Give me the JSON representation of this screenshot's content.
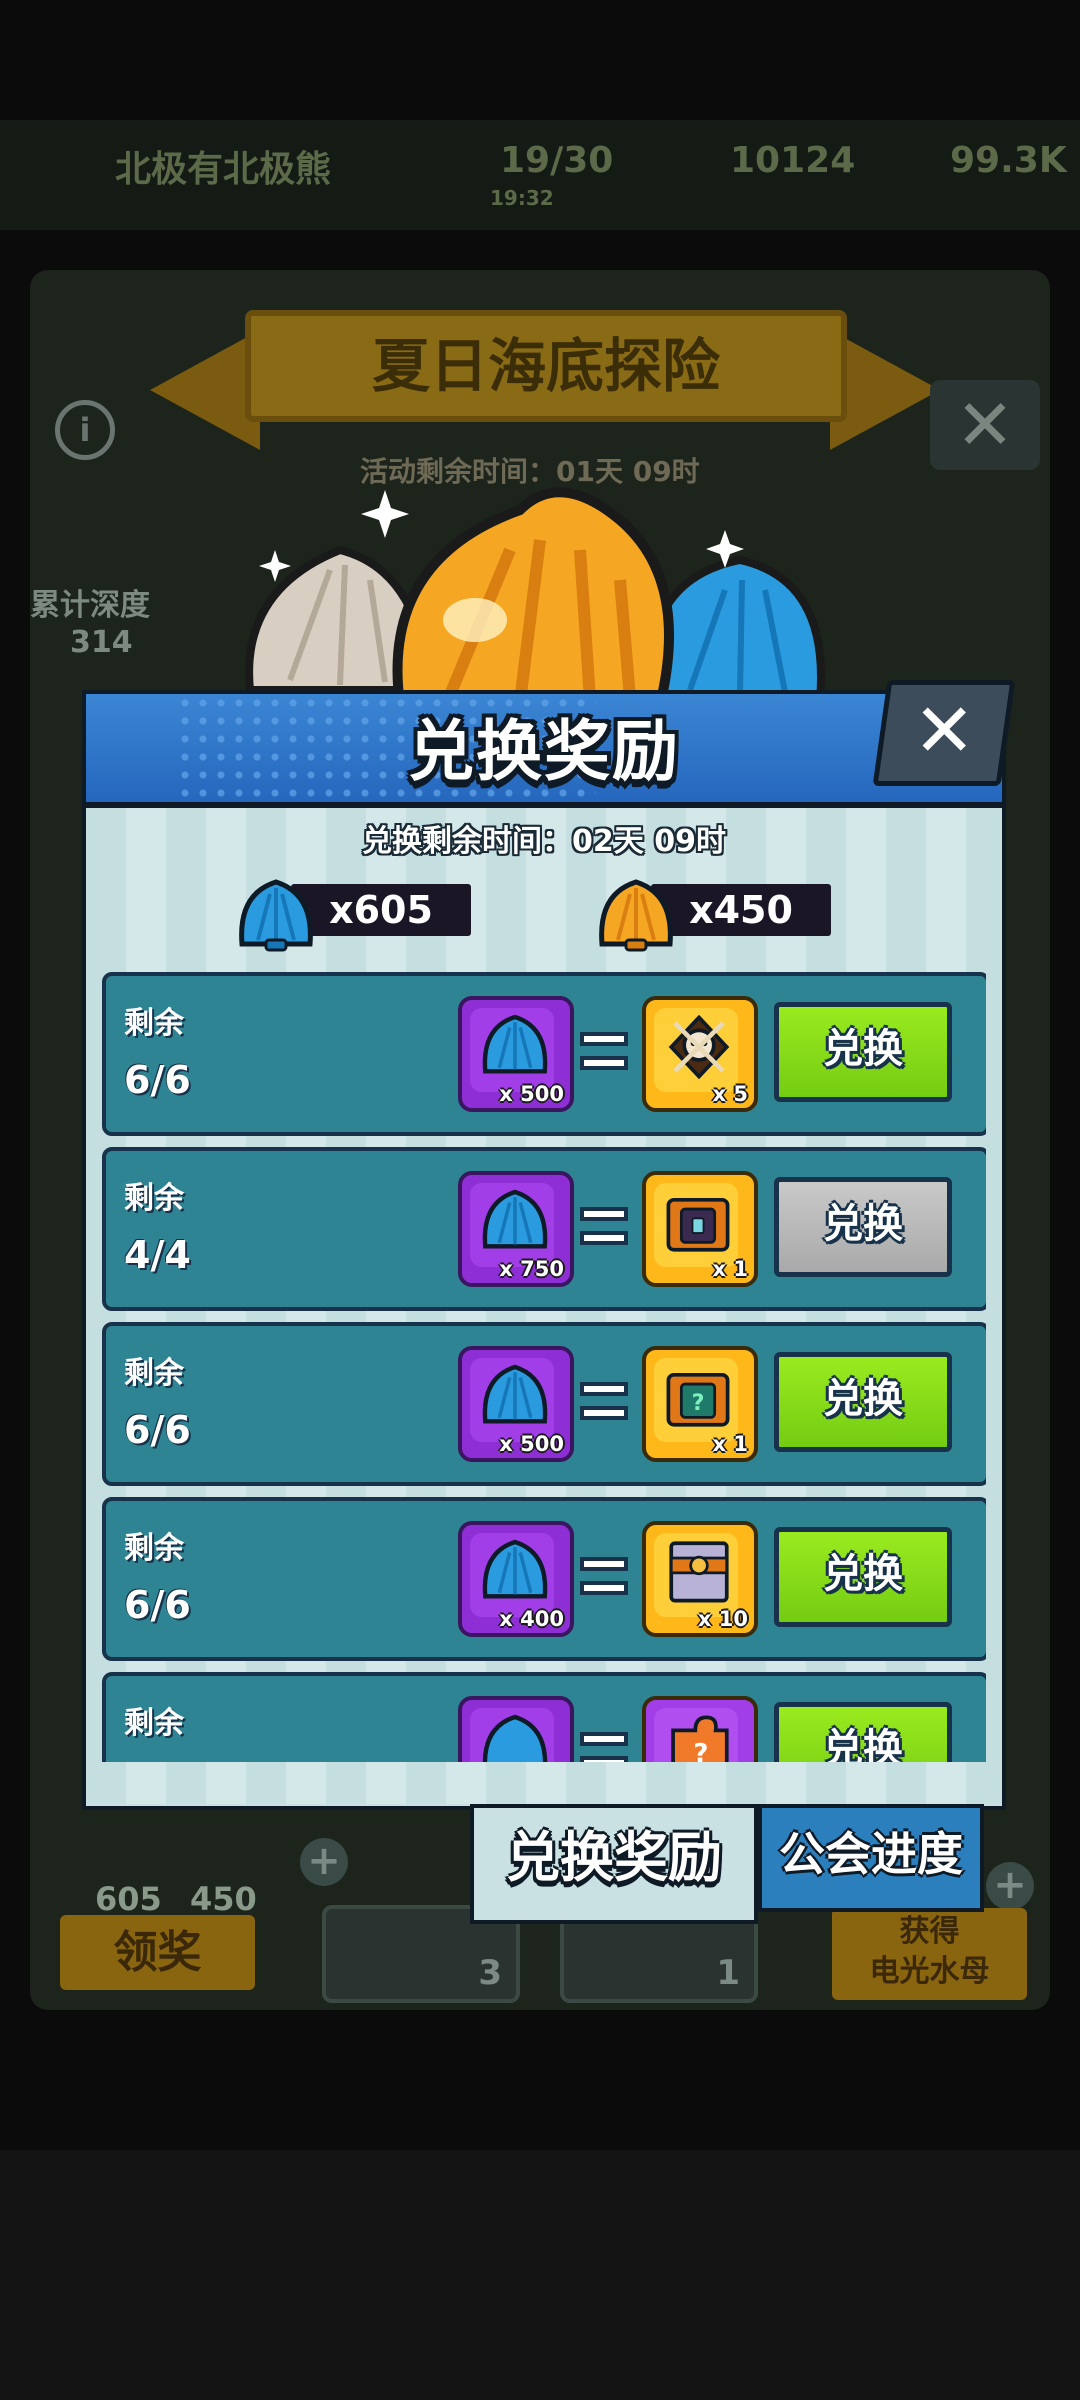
{
  "background": {
    "top_bar": {
      "player_name": "北极有北极熊",
      "energy": "19/30",
      "energy_timer": "19:32",
      "coins": "10124",
      "gems": "99.3K"
    },
    "banner_title": "夏日海底探险",
    "activity_remaining": "活动剩余时间：01天 09时",
    "depth_label": "累计深度",
    "depth_value": "314",
    "blue_shell_count": "605",
    "gold_shell_count": "450",
    "claim_label": "领奖",
    "slot_a_count": "3",
    "slot_b_count": "1",
    "obtain_label_line1": "获得",
    "obtain_label_line2": "电光水母"
  },
  "modal": {
    "title": "兑换奖励",
    "timer": "兑换剩余时间：02天 09时",
    "currencies": [
      {
        "icon": "blue-shell-icon",
        "amount": "x605"
      },
      {
        "icon": "gold-shell-icon",
        "amount": "x450"
      }
    ],
    "rows": [
      {
        "remain_label": "剩余",
        "count": "6/6",
        "cost": "x 500",
        "reward": "x 5",
        "reward_icon": "pirate-badge-icon",
        "button": "兑换",
        "enabled": true
      },
      {
        "remain_label": "剩余",
        "count": "4/4",
        "cost": "x 750",
        "reward": "x 1",
        "reward_icon": "dark-chest-icon",
        "button": "兑换",
        "enabled": false
      },
      {
        "remain_label": "剩余",
        "count": "6/6",
        "cost": "x 500",
        "reward": "x 1",
        "reward_icon": "mystery-chest-icon",
        "button": "兑换",
        "enabled": true
      },
      {
        "remain_label": "剩余",
        "count": "6/6",
        "cost": "x 400",
        "reward": "x 10",
        "reward_icon": "ticket-stack-icon",
        "button": "兑换",
        "enabled": true
      },
      {
        "remain_label": "剩余",
        "count": "",
        "cost": "",
        "reward": "",
        "reward_icon": "puzzle-piece-icon",
        "button": "兑换",
        "enabled": true
      }
    ]
  },
  "tabs": {
    "active": "兑换奖励",
    "inactive": "公会进度"
  },
  "colors": {
    "header_blue": "#2f78c9",
    "row_teal": "#2f8494",
    "button_green": "#85dd18",
    "button_gray": "#b9b9b9",
    "cost_purple": "#8e2fd6",
    "reward_gold": "#ffb81a"
  }
}
